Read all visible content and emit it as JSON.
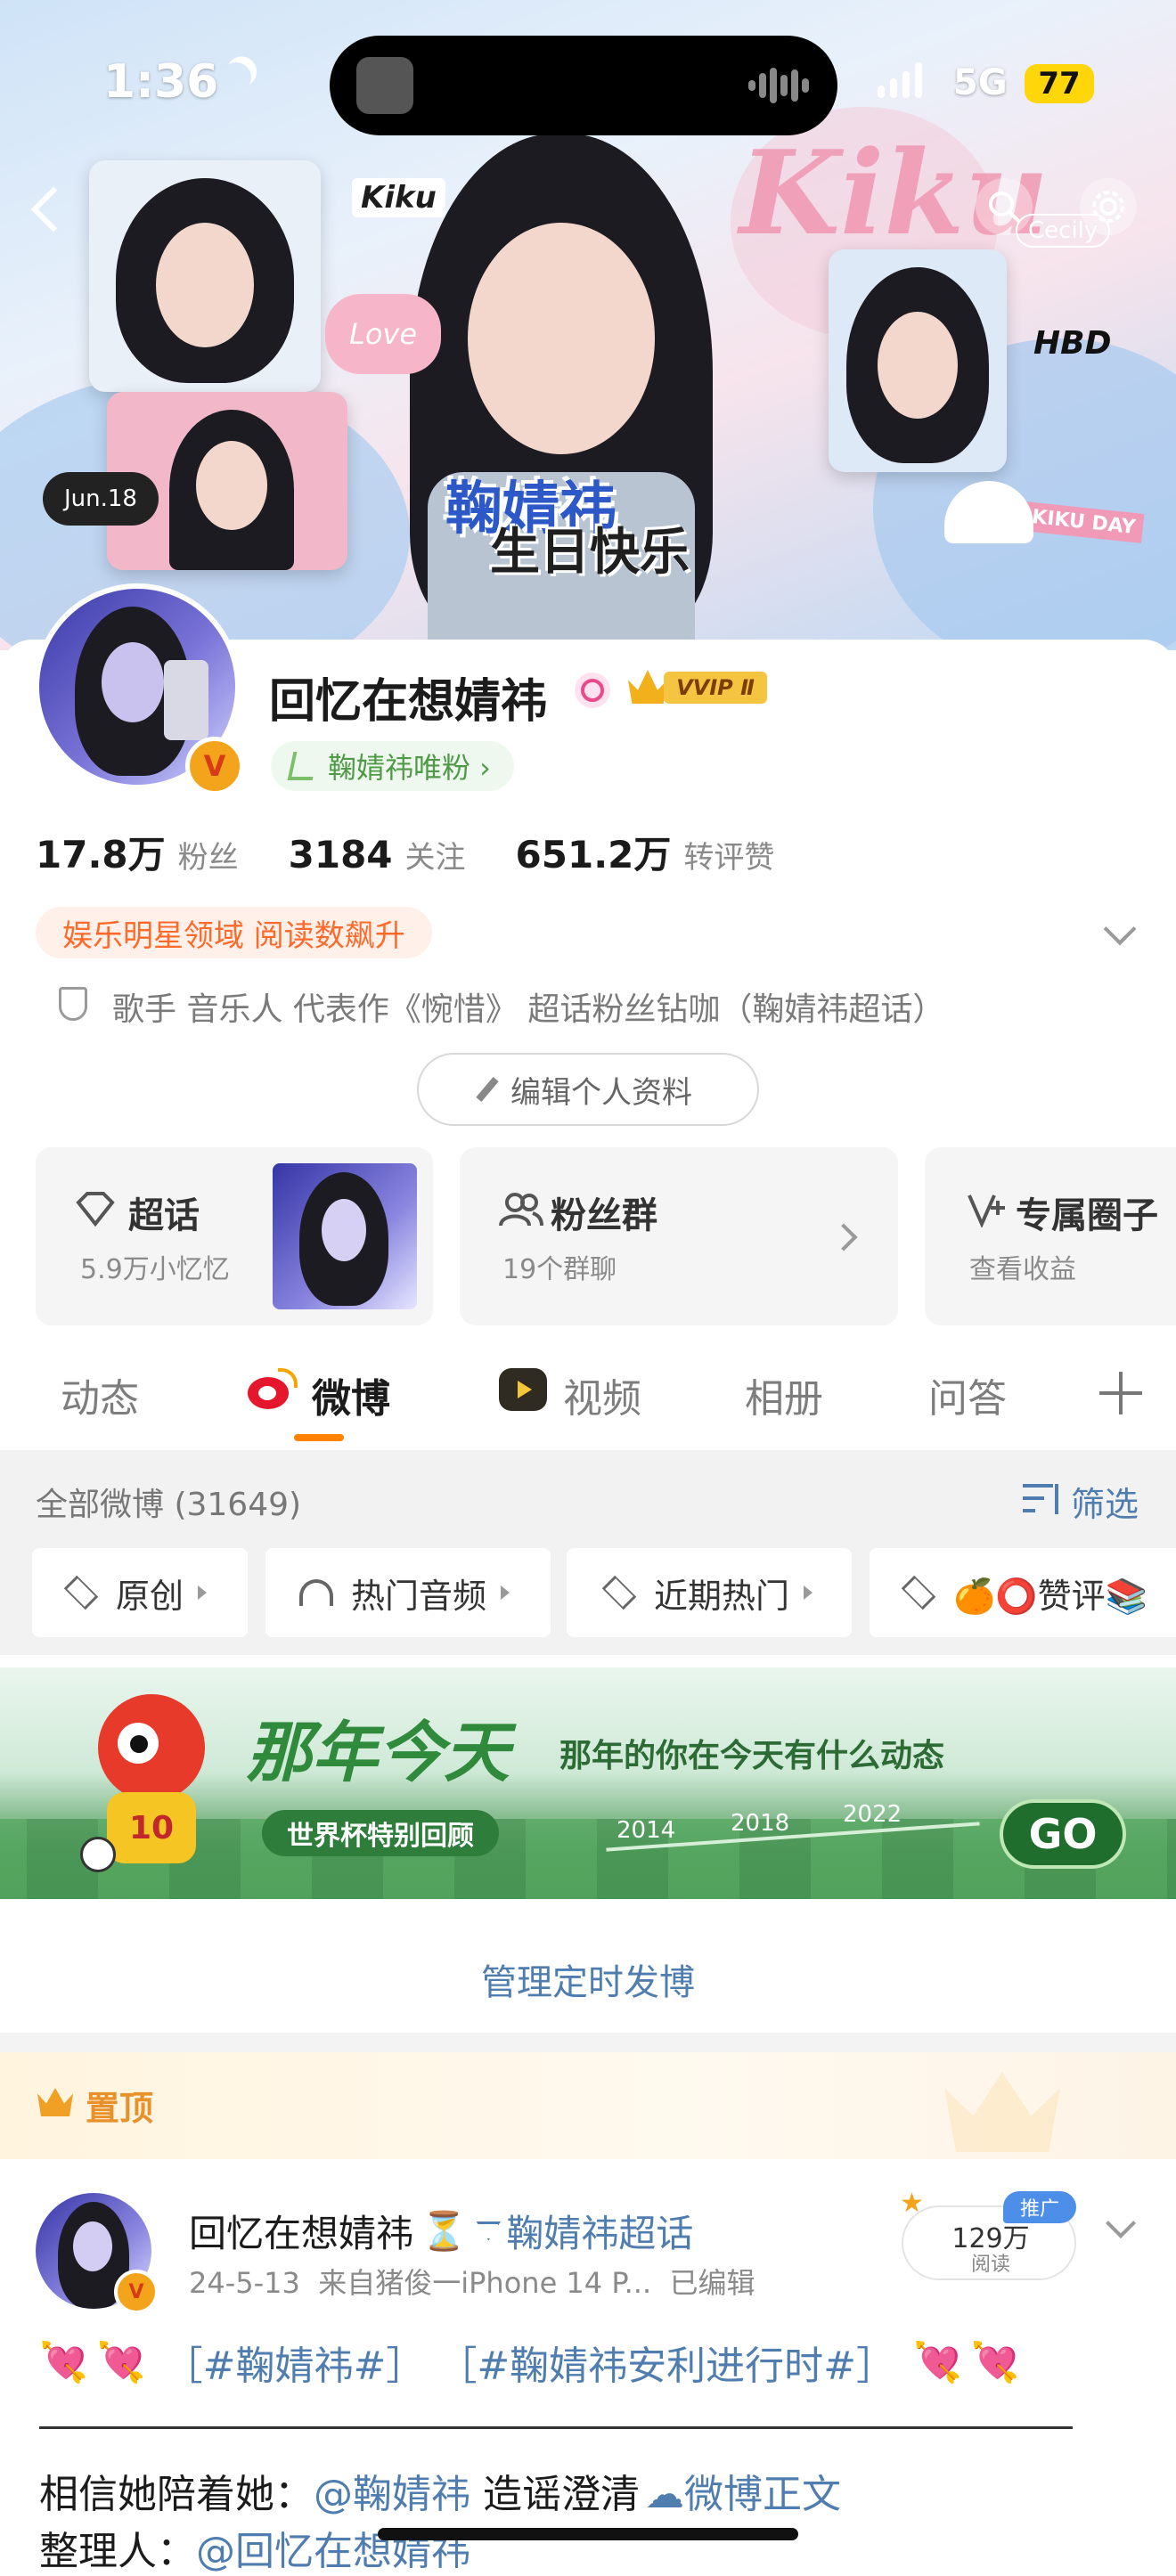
{
  "status_bar": {
    "time": "1:36",
    "network": "5G",
    "battery": "77"
  },
  "banner": {
    "title_line1": "鞠婧祎",
    "title_line2": "生日快乐",
    "sticker_kiku": "Kiku",
    "sticker_love": "Love",
    "sticker_date": "Jun.18",
    "sticker_hbd": "HBD",
    "sticker_cecily": "Cecily",
    "sticker_kikuday": "KIKU DAY",
    "big_script": "Kiku"
  },
  "profile": {
    "name": "回忆在想婧祎",
    "vip_label": "VVIP Ⅱ",
    "fan_tag": "鞠婧祎唯粉 ›",
    "stats": [
      {
        "value": "17.8万",
        "label": "粉丝"
      },
      {
        "value": "3184",
        "label": "关注"
      },
      {
        "value": "651.2万",
        "label": "转评赞"
      }
    ],
    "honor_tag": "娱乐明星领域 阅读数飙升",
    "bio": "歌手 音乐人 代表作《惋惜》 超话粉丝钻咖（鞠婧祎超话）",
    "edit_button": "编辑个人资料"
  },
  "tiles": [
    {
      "title": "超话",
      "sub": "5.9万小忆忆"
    },
    {
      "title": "粉丝群",
      "sub": "19个群聊"
    },
    {
      "title": "专属圈子",
      "sub": "查看收益"
    }
  ],
  "tabs": [
    "动态",
    "微博",
    "视频",
    "相册",
    "问答"
  ],
  "active_tab": 1,
  "filter_bar": {
    "count_label": "全部微博 (31649)",
    "filter_label": "筛选"
  },
  "chips": [
    "原创",
    "热门音频",
    "近期热门",
    "🍊⭕赞评📚"
  ],
  "promo": {
    "title": "那年今天",
    "subtitle": "那年的你在今天有什么动态",
    "badge": "世界杯特别回顾",
    "years": [
      "2014",
      "2018",
      "2022"
    ],
    "go": "GO",
    "jersey": "10"
  },
  "manage_label": "管理定时发博",
  "pinned_label": "置顶",
  "post": {
    "author": "回忆在想婧祎",
    "emoji": "⏳",
    "topic_link": "鞠婧祎超话",
    "meta": "24-5-13  来自猪俊一iPhone 14 P...  已编辑",
    "promo_tag": "推广",
    "reads_value": "129万",
    "reads_label": "阅读",
    "line1_tags": "［#鞠婧祎#］ ［#鞠婧祎安利进行时#］",
    "line2_prefix": "相信她陪着她：",
    "line2_mention": "@鞠婧祎",
    "line2_mid": " 造谣澄清",
    "line2_link": "微博正文",
    "line3_prefix": "整理人：",
    "line3_mention": "@回忆在想婧祎"
  },
  "colors": {
    "accent": "#ff8200",
    "link": "#507daf",
    "honor_bg": "#fff1ea",
    "honor_text": "#ff6a2a"
  }
}
